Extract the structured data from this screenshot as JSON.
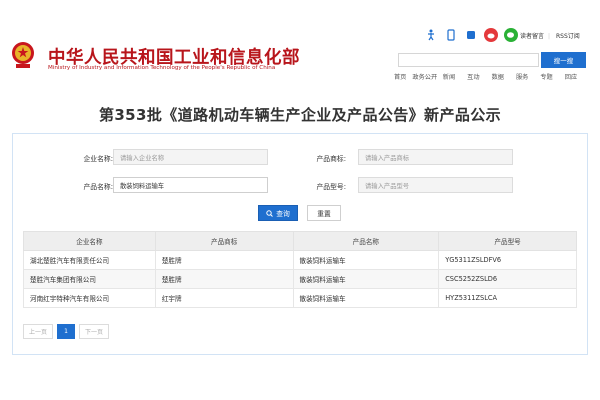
{
  "header": {
    "site_title": "中华人民共和国工业和信息化部",
    "site_subtitle": "Ministry of Industry and Information Technology of the People's Republic of China",
    "top_links": [
      "读者留言",
      "RSS订阅"
    ],
    "search_button": "搜一搜",
    "nav_items": [
      "首页",
      "政务公开",
      "新闻",
      "互动",
      "数据",
      "服务",
      "专题",
      "回应"
    ],
    "colors": {
      "brand_red": "#b8151b",
      "accent_blue": "#1f6fcf"
    }
  },
  "page": {
    "title": "第353批《道路机动车辆生产企业及产品公告》新产品公示"
  },
  "form": {
    "company_label": "企业名称:",
    "company_placeholder": "请输入企业名称",
    "brand_label": "产品商标:",
    "brand_placeholder": "请输入产品商标",
    "product_label": "产品名称:",
    "product_value": "散装饲料运输车",
    "model_label": "产品型号:",
    "model_placeholder": "请输入产品型号",
    "query_button": "查询",
    "reset_button": "重置"
  },
  "table": {
    "headers": [
      "企业名称",
      "产品商标",
      "产品名称",
      "产品型号"
    ],
    "rows": [
      [
        "湖北楚胜汽车有限责任公司",
        "楚胜牌",
        "散装饲料运输车",
        "YG5311ZSLDFV6"
      ],
      [
        "楚胜汽车集团有限公司",
        "楚胜牌",
        "散装饲料运输车",
        "CSC5252ZSLD6"
      ],
      [
        "河南红宇特种汽车有限公司",
        "红宇牌",
        "散装饲料运输车",
        "HYZ5311ZSLCA"
      ]
    ]
  },
  "pager": {
    "prev": "上一页",
    "current": "1",
    "next": "下一页"
  }
}
